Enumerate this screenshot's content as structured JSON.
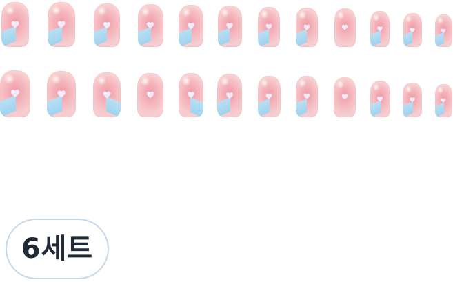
{
  "product": {
    "set_badge_label": "6세트",
    "colors": {
      "nail_base": "#f8d3d3",
      "nail_blush": "#ef9aa6",
      "tip_blue": "#a6d6ef",
      "heart": "#f4e9f7",
      "badge_border": "#c7d7e6",
      "badge_text": "#1f2a36"
    },
    "nail_design": {
      "icon": "heart-icon",
      "tip_style": "blue-side-tip"
    },
    "rows": [
      {
        "nails": [
          {
            "tip": "left"
          },
          {
            "tip": "left"
          },
          {
            "tip": "left"
          },
          {
            "tip": "left"
          },
          {
            "tip": "left"
          },
          {
            "tip": "left"
          },
          {
            "tip": "left"
          },
          {
            "tip": "left"
          },
          {
            "tip": "none"
          },
          {
            "tip": "left"
          },
          {
            "tip": "left"
          },
          {
            "tip": "left"
          }
        ]
      },
      {
        "nails": [
          {
            "tip": "left"
          },
          {
            "tip": "left"
          },
          {
            "tip": "right"
          },
          {
            "tip": "none"
          },
          {
            "tip": "right"
          },
          {
            "tip": "left"
          },
          {
            "tip": "left"
          },
          {
            "tip": "left"
          },
          {
            "tip": "none"
          },
          {
            "tip": "left"
          },
          {
            "tip": "left"
          },
          {
            "tip": "left"
          }
        ]
      }
    ]
  }
}
